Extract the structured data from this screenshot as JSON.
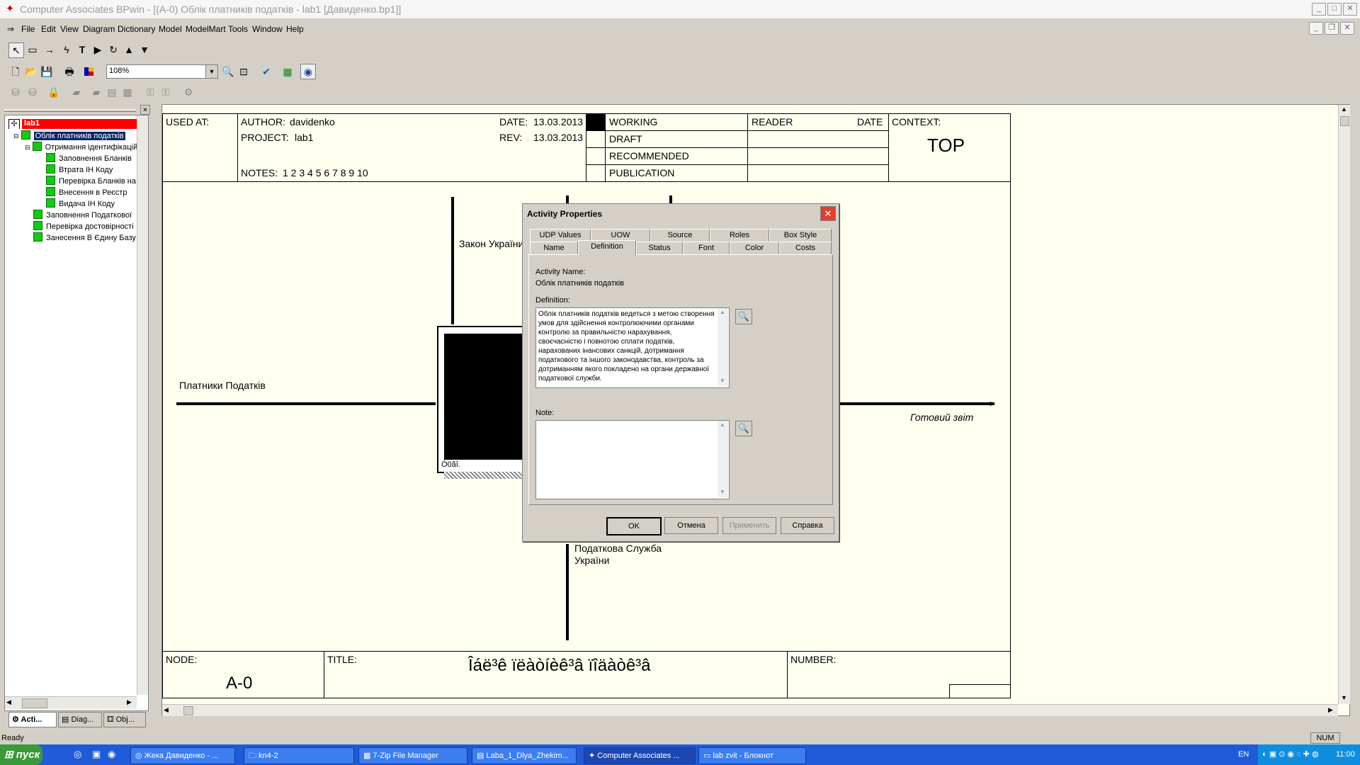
{
  "window": {
    "title": "Computer Associates BPwin - [(A-0) Облік платників податків    - lab1  [Давиденко.bp1]]",
    "min": "_",
    "max": "□",
    "close": "✕"
  },
  "menu": [
    "File",
    "Edit",
    "View",
    "Diagram",
    "Dictionary",
    "Model",
    "ModelMart",
    "Tools",
    "Window",
    "Help"
  ],
  "toolbar": {
    "zoom": "108%"
  },
  "tree": {
    "root": "lab1",
    "items": [
      {
        "label": "Облік платників податків",
        "level": 1
      },
      {
        "label": "Отримання ідентифікаційного",
        "level": 2
      },
      {
        "label": "Заповнення Бланків",
        "level": 3
      },
      {
        "label": "Втрата ІН Коду",
        "level": 3
      },
      {
        "label": "Перевірка Бланків на",
        "level": 3
      },
      {
        "label": "Внесення в Реєстр",
        "level": 3
      },
      {
        "label": "Видача ІН Коду",
        "level": 3
      },
      {
        "label": "Заповнення Податкової",
        "level": 2
      },
      {
        "label": "Перевірка достовірності",
        "level": 2
      },
      {
        "label": "Занесення В Єдину Базу",
        "level": 2
      }
    ],
    "tabs": [
      "Acti...",
      "Diag...",
      "Obj..."
    ]
  },
  "frame": {
    "used_at": "USED AT:",
    "author_label": "AUTHOR:",
    "author": "davidenko",
    "project_label": "PROJECT:",
    "project": "lab1",
    "date_label": "DATE:",
    "date": "13.03.2013",
    "rev_label": "REV:",
    "rev": "13.03.2013",
    "notes_label": "NOTES:",
    "notes": "1  2  3  4  5  6  7  8  9  10",
    "working": "WORKING",
    "draft": "DRAFT",
    "recommended": "RECOMMENDED",
    "publication": "PUBLICATION",
    "reader": "READER",
    "date2": "DATE",
    "context_label": "CONTEXT:",
    "context": "TOP",
    "node_label": "NODE:",
    "node": "A-0",
    "title_label": "TITLE:",
    "title": "Îáë³ê ïëàòíèê³â ïîäàòê³â",
    "number_label": "NUMBER:"
  },
  "diagram": {
    "input": "Платники Податків",
    "control": "Закон України",
    "output": "Готовий звіт",
    "mechanism": "Податкова Служба\nУкраїни",
    "box_caption": "Ó0ãî."
  },
  "dialog": {
    "title": "Activity Properties",
    "tabs_row1": [
      "UDP Values",
      "UOW",
      "Source",
      "Roles",
      "Box Style"
    ],
    "tabs_row2": [
      "Name",
      "Definition",
      "Status",
      "Font",
      "Color",
      "Costs"
    ],
    "activity_name_label": "Activity Name:",
    "activity_name": "Облік платників податків",
    "definition_label": "Definition:",
    "definition": "Облік платників податків ведеться з метою створення умов для здійснення контролюючими органами контролю за правильністю нарахування, своєчасністю і повнотою сплати податків, нарахованих інансових санкцій, дотримання податкового та іншого законодавства, контроль за дотриманням якого покладено на органи державної податкової служби.",
    "note_label": "Note:",
    "note": "",
    "buttons": [
      "OK",
      "Отмена",
      "Применить",
      "Справка"
    ]
  },
  "status": {
    "ready": "Ready",
    "num": "NUM"
  },
  "taskbar": {
    "start": "пуск",
    "tasks": [
      "Жека Давиденко - ...",
      "kn4-2",
      "7-Zip File Manager",
      "Laba_1_Dlya_Zhekim...",
      "Computer Associates ...",
      "lab zvit - Блокнот"
    ],
    "lang": "EN",
    "clock": "11:00"
  }
}
